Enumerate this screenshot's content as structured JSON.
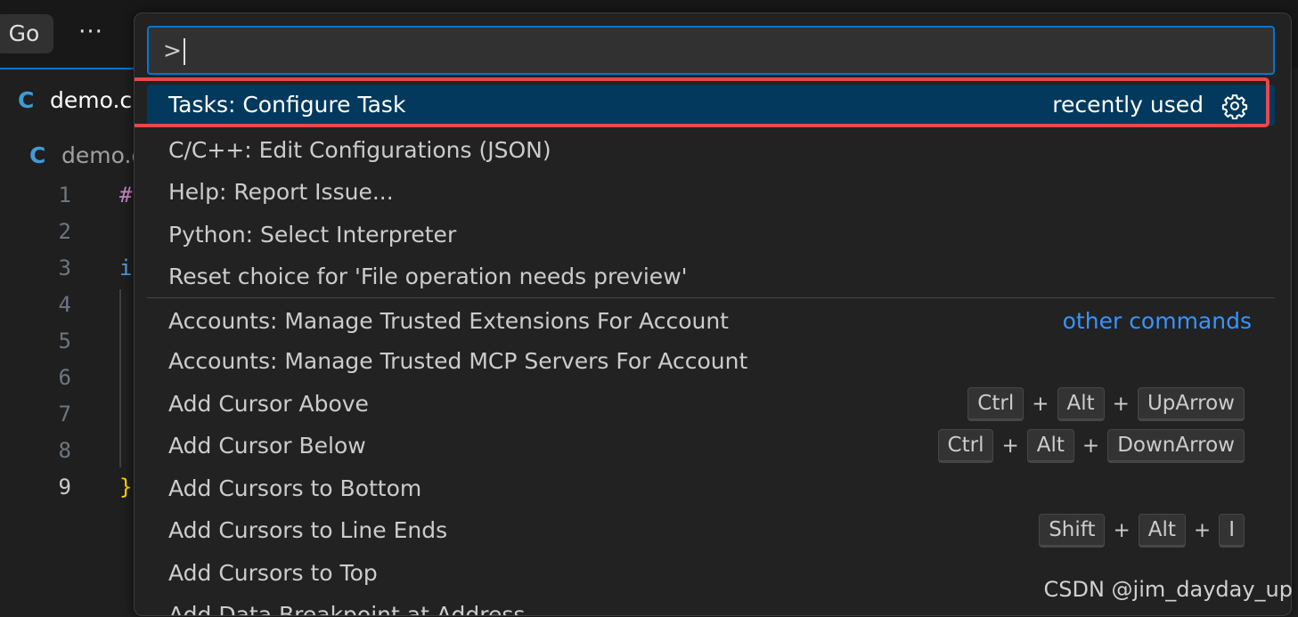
{
  "toolbar": {
    "go_label": "Go",
    "more_label": "···"
  },
  "editor": {
    "tab_icon": "C",
    "tab_label": "demo.c",
    "breadcrumb_icon": "C",
    "breadcrumb_label": "demo.c",
    "line_numbers": [
      "1",
      "2",
      "3",
      "4",
      "5",
      "6",
      "7",
      "8",
      "9"
    ],
    "active_line": "9",
    "code_fragments": {
      "line1": "#",
      "line3": "i",
      "line9": "}"
    }
  },
  "palette": {
    "input_value": ">",
    "items": [
      {
        "label": "Tasks: Configure Task",
        "badge": "recently used",
        "icon": "gear-icon"
      },
      {
        "label": "C/C++: Edit Configurations (JSON)"
      },
      {
        "label": "Help: Report Issue..."
      },
      {
        "label": "Python: Select Interpreter"
      },
      {
        "label": "Reset choice for 'File operation needs preview'"
      },
      {
        "label": "Accounts: Manage Trusted Extensions For Account",
        "badge": "other commands"
      },
      {
        "label": "Accounts: Manage Trusted MCP Servers For Account"
      },
      {
        "label": "Add Cursor Above",
        "keys": [
          "Ctrl",
          "Alt",
          "UpArrow"
        ]
      },
      {
        "label": "Add Cursor Below",
        "keys": [
          "Ctrl",
          "Alt",
          "DownArrow"
        ]
      },
      {
        "label": "Add Cursors to Bottom"
      },
      {
        "label": "Add Cursors to Line Ends",
        "keys": [
          "Shift",
          "Alt",
          "I"
        ]
      },
      {
        "label": "Add Cursors to Top"
      },
      {
        "label": "Add Data Breakpoint at Address"
      }
    ],
    "key_separator": "+"
  },
  "watermark": "CSDN @jim_dayday_up",
  "colors": {
    "selection": "#04395e",
    "focus_border": "#0078d4",
    "highlight_box": "#e5484d",
    "link": "#3794ff"
  }
}
